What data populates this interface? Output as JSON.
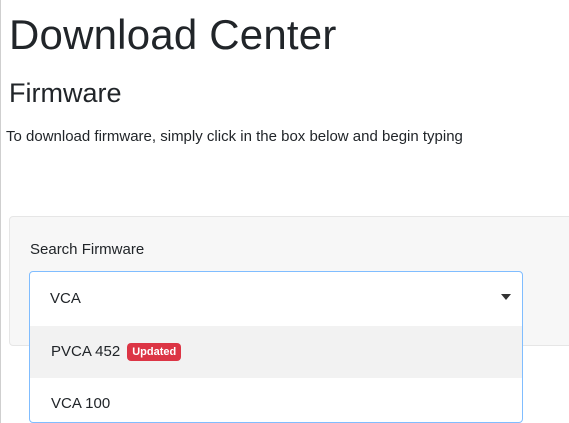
{
  "header": {
    "title": "Download Center",
    "section": "Firmware",
    "intro": "To download firmware, simply click in the box below and begin typing"
  },
  "search": {
    "label": "Search Firmware",
    "value": "VCA",
    "options": [
      {
        "label": "PVCA 452",
        "badge": "Updated",
        "highlighted": true
      },
      {
        "label": "VCA 100",
        "badge": null,
        "highlighted": false
      }
    ]
  },
  "colors": {
    "badge": "#dc3545",
    "focus_border": "#80bdff",
    "panel_bg": "#f7f7f7",
    "highlight_bg": "#f2f2f2"
  }
}
